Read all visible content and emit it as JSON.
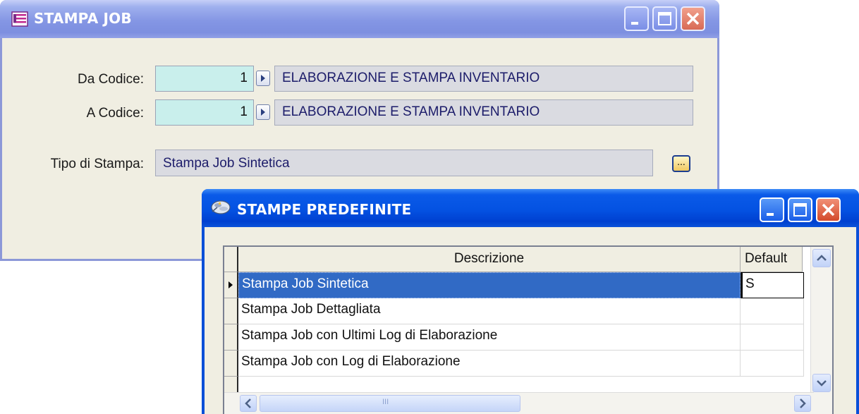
{
  "window_main": {
    "title": "STAMPA JOB",
    "da_codice_label": "Da Codice:",
    "da_codice_value": "1",
    "da_codice_desc": "ELABORAZIONE E STAMPA INVENTARIO",
    "a_codice_label": "A Codice:",
    "a_codice_value": "1",
    "a_codice_desc": "ELABORAZIONE E STAMPA INVENTARIO",
    "tipo_label": "Tipo di Stampa:",
    "tipo_value": "Stampa Job Sintetica",
    "ellipsis_label": "..."
  },
  "window_popup": {
    "title": "STAMPE PREDEFINITE",
    "columns": {
      "descrizione": "Descrizione",
      "default": "Default"
    },
    "rows": [
      {
        "descrizione": "Stampa Job Sintetica",
        "default": "S"
      },
      {
        "descrizione": "Stampa Job Dettagliata",
        "default": ""
      },
      {
        "descrizione": "Stampa Job con Ultimi Log di Elaborazione",
        "default": ""
      },
      {
        "descrizione": "Stampa Job con Log di Elaborazione",
        "default": ""
      }
    ],
    "hscroll_grip": "III"
  },
  "colors": {
    "active_title": "#0452e2",
    "inactive_title": "#8496e4",
    "selection": "#316ac5",
    "code_field": "#c9efec"
  },
  "icons": {
    "main_window": "list-document-icon",
    "popup_window": "printer-settings-icon"
  }
}
